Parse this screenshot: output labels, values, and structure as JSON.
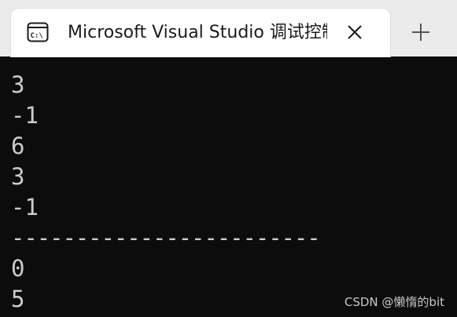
{
  "tab": {
    "title": "Microsoft Visual Studio 调试控制台",
    "icon": "console-icon",
    "close_icon": "close-icon",
    "new_tab_icon": "plus-icon"
  },
  "console": {
    "lines": [
      "3",
      "-1",
      "6",
      "3",
      "-1",
      "------------------------",
      "0",
      "5"
    ]
  },
  "watermark": "CSDN @懒惰的bit",
  "colors": {
    "tabbar": "#ebebeb",
    "tab": "#ffffff",
    "console_bg": "#0c0c0c",
    "console_text": "#cccccc"
  }
}
